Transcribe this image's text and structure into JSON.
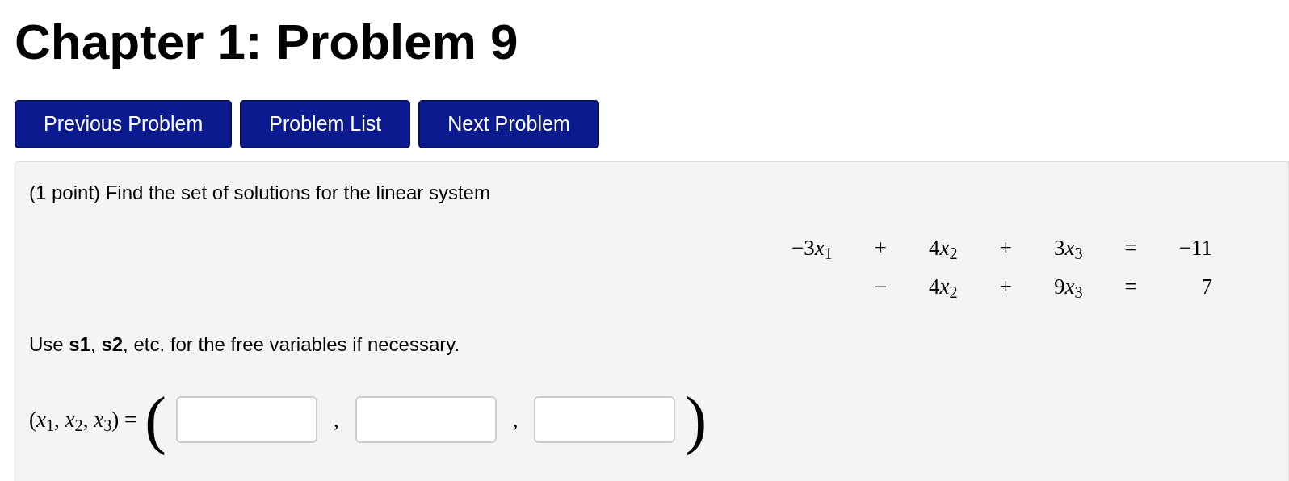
{
  "title": "Chapter 1: Problem 9",
  "nav_buttons": [
    "Previous Problem",
    "Problem List",
    "Next Problem"
  ],
  "problem": {
    "statement": "(1 point) Find the set of solutions for the linear system",
    "equations": [
      [
        {
          "kind": "term",
          "coefficient": "−3",
          "variable": "*x*$_{1}$"
        },
        {
          "kind": "op",
          "text": "+"
        },
        {
          "kind": "term",
          "coefficient": "4",
          "variable": "*x*$_{2}$"
        },
        {
          "kind": "op",
          "text": "+"
        },
        {
          "kind": "term",
          "coefficient": "3",
          "variable": "*x*$_{3}$"
        },
        {
          "kind": "op",
          "text": "="
        },
        {
          "kind": "value",
          "text": "−11"
        }
      ],
      [
        {
          "kind": "blank"
        },
        {
          "kind": "op",
          "text": "−"
        },
        {
          "kind": "term",
          "coefficient": "4",
          "variable": "*x*$_{2}$"
        },
        {
          "kind": "op",
          "text": "+"
        },
        {
          "kind": "term",
          "coefficient": "9",
          "variable": "*x*$_{3}$"
        },
        {
          "kind": "op",
          "text": "="
        },
        {
          "kind": "value",
          "text": "7"
        }
      ]
    ],
    "instruction": "Use **s1**, **s2**, etc. for the free variables if necessary.",
    "answer": {
      "label": "(*x*$_{1}$, *x*$_{2}$, *x*$_{3}$) =",
      "open_paren": "(",
      "separators": [
        ",",
        ","
      ],
      "close_paren": ")",
      "fields": [
        {
          "kind": "text"
        },
        {
          "kind": "text"
        },
        {
          "kind": "text"
        }
      ]
    }
  }
}
